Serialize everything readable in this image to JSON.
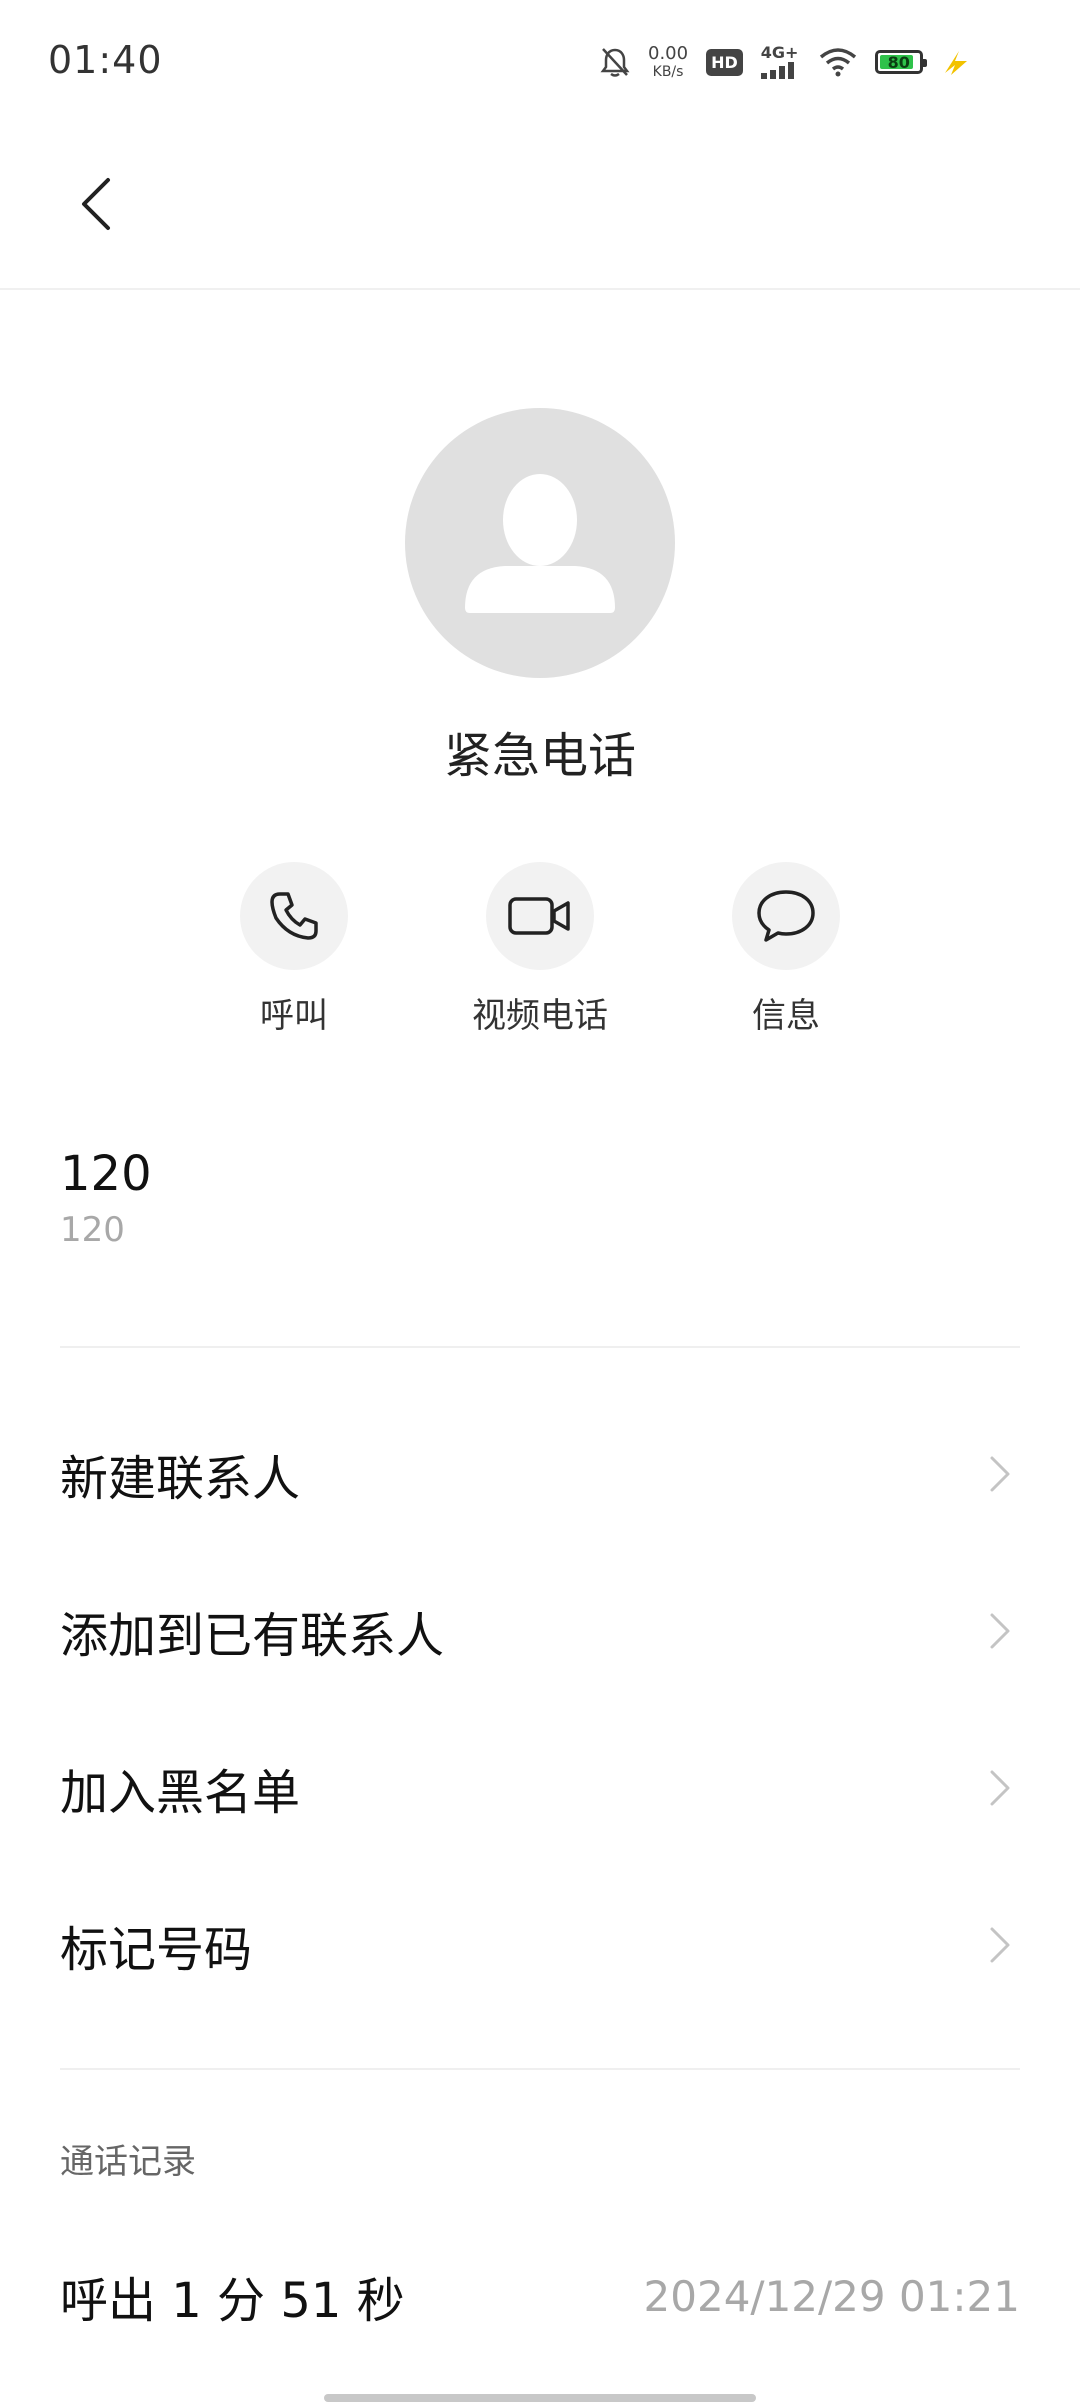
{
  "status_bar": {
    "time": "01:40",
    "net_speed_value": "0.00",
    "net_speed_unit": "KB/s",
    "hd_label": "HD",
    "network_label": "4G+",
    "battery_level": "80",
    "battery_color": "#2fc24a",
    "charging_color": "#f2c200",
    "icons": [
      "bell-off-icon",
      "hd-icon",
      "signal-icon",
      "wifi-icon",
      "battery-icon",
      "charging-icon"
    ]
  },
  "header": {
    "back_icon": "chevron-left-icon"
  },
  "contact": {
    "name": "紧急电话",
    "avatar_icon": "person-icon"
  },
  "actions": [
    {
      "label": "呼叫",
      "icon": "phone-icon"
    },
    {
      "label": "视频电话",
      "icon": "video-camera-icon"
    },
    {
      "label": "信息",
      "icon": "message-bubble-icon"
    }
  ],
  "number": {
    "primary": "120",
    "secondary": "120"
  },
  "menu": [
    {
      "label": "新建联系人"
    },
    {
      "label": "添加到已有联系人"
    },
    {
      "label": "加入黑名单"
    },
    {
      "label": "标记号码"
    }
  ],
  "call_log": {
    "title": "通话记录",
    "entries": [
      {
        "description": "呼出 1 分 51 秒",
        "datetime": "2024/12/29 01:21"
      }
    ]
  }
}
